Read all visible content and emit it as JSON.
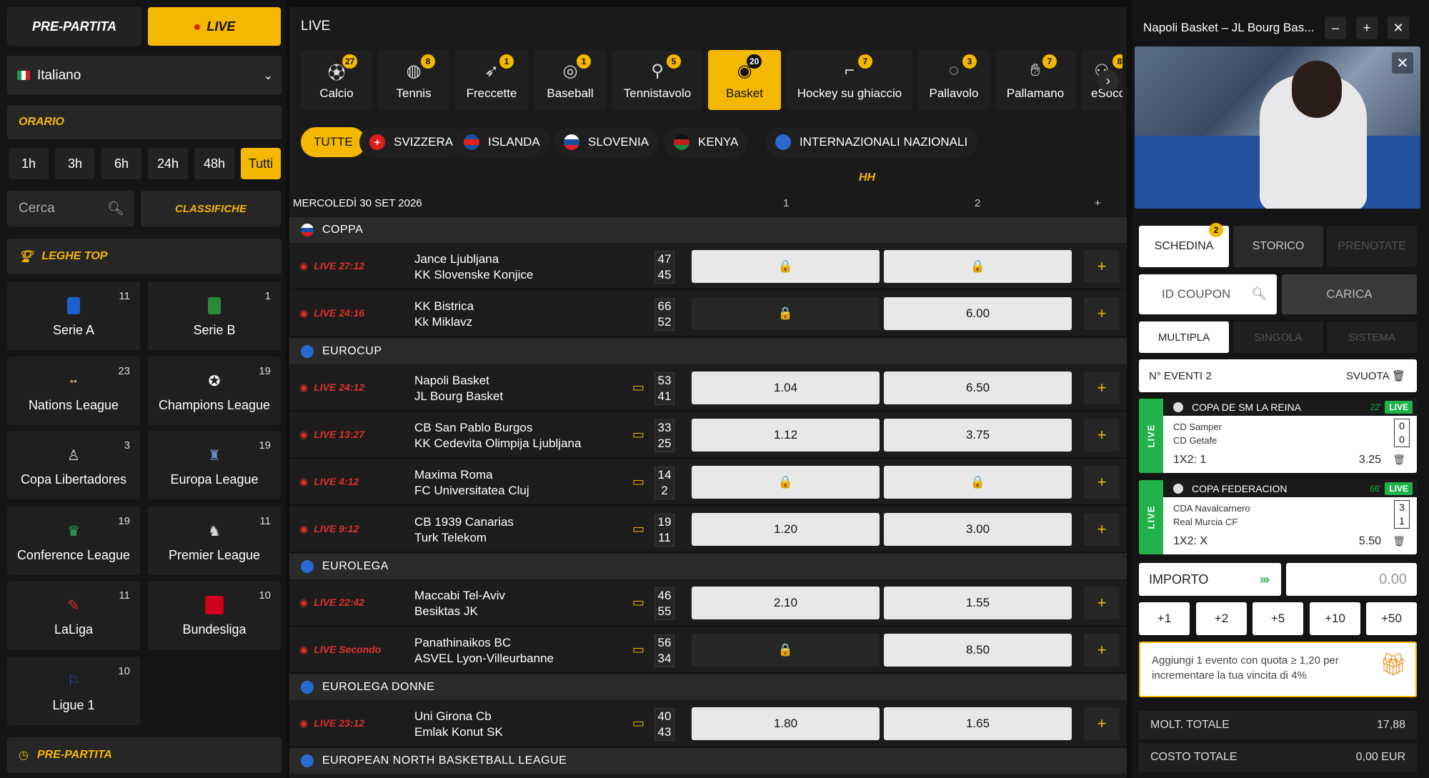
{
  "left": {
    "prepartita_label": "PRE-PARTITA",
    "live_label": "LIVE",
    "language": "Italiano",
    "orario_label": "ORARIO",
    "time_filters": [
      "1h",
      "3h",
      "6h",
      "24h",
      "48h",
      "Tutti"
    ],
    "search_placeholder": "Cerca",
    "classifiche_label": "CLASSIFICHE",
    "leghe_top_label": "LEGHE TOP",
    "leagues": [
      {
        "name": "Serie A",
        "count": "11",
        "icon": "serie-a-icon"
      },
      {
        "name": "Serie B",
        "count": "1",
        "icon": "serie-b-icon"
      },
      {
        "name": "Nations League",
        "count": "23",
        "icon": "nations-league-icon"
      },
      {
        "name": "Champions League",
        "count": "19",
        "icon": "champions-league-icon"
      },
      {
        "name": "Copa Libertadores",
        "count": "3",
        "icon": "copa-libertadores-icon"
      },
      {
        "name": "Europa League",
        "count": "19",
        "icon": "europa-league-icon"
      },
      {
        "name": "Conference League",
        "count": "19",
        "icon": "conference-league-icon"
      },
      {
        "name": "Premier League",
        "count": "11",
        "icon": "premier-league-icon"
      },
      {
        "name": "LaLiga",
        "count": "11",
        "icon": "laliga-icon"
      },
      {
        "name": "Bundesliga",
        "count": "10",
        "icon": "bundesliga-icon"
      },
      {
        "name": "Ligue 1",
        "count": "10",
        "icon": "ligue-1-icon"
      }
    ],
    "prepartita_footer": "PRE-PARTITA"
  },
  "center": {
    "title": "LIVE",
    "sports": [
      {
        "label": "Calcio",
        "count": "27",
        "icon": "soccer-ball-icon"
      },
      {
        "label": "Tennis",
        "count": "8",
        "icon": "tennis-ball-icon"
      },
      {
        "label": "Freccette",
        "count": "1",
        "icon": "dart-icon"
      },
      {
        "label": "Baseball",
        "count": "1",
        "icon": "baseball-icon"
      },
      {
        "label": "Tennistavolo",
        "count": "5",
        "icon": "ping-pong-icon"
      },
      {
        "label": "Basket",
        "count": "20",
        "icon": "basketball-icon",
        "active": true
      },
      {
        "label": "Hockey su ghiaccio",
        "count": "7",
        "icon": "hockey-stick-icon"
      },
      {
        "label": "Pallavolo",
        "count": "3",
        "icon": "volleyball-icon"
      },
      {
        "label": "Pallamano",
        "count": "7",
        "icon": "handball-icon"
      },
      {
        "label": "eSocce",
        "count": "8",
        "icon": "esoccer-icon"
      }
    ],
    "countries": [
      "TUTTE",
      "SVIZZERA",
      "ISLANDA",
      "SLOVENIA",
      "KENYA",
      "INTERNAZIONALI NAZIONALI"
    ],
    "hh_label": "HH",
    "date_header": "MERCOLEDÌ 30 SET 2026",
    "col1": "1",
    "col2": "2",
    "col_plus": "+",
    "groups": {
      "coppa": "COPPA",
      "eurocup": "EUROCUP",
      "eurolega": "EUROLEGA",
      "eurolega_donne": "EUROLEGA DONNE",
      "enbl": "EUROPEAN NORTH BASKETBALL LEAGUE"
    },
    "matches": [
      {
        "live": "LIVE 27:12",
        "home": "Jance Ljubljana",
        "away": "KK Slovenske Konjice",
        "s1": "47",
        "s2": "45",
        "o1": "🔒",
        "o2": "🔒",
        "tv": false
      },
      {
        "live": "LIVE 24:16",
        "home": "KK Bistrica",
        "away": "Kk Miklavz",
        "s1": "66",
        "s2": "52",
        "o1": "🔒",
        "o2": "6.00",
        "tv": false
      },
      {
        "live": "LIVE 24:12",
        "home": "Napoli Basket",
        "away": "JL Bourg Basket",
        "s1": "53",
        "s2": "41",
        "o1": "1.04",
        "o2": "6.50",
        "tv": true
      },
      {
        "live": "LIVE 13:27",
        "home": "CB San Pablo Burgos",
        "away": "KK Cedevita Olimpija Ljubljana",
        "s1": "33",
        "s2": "25",
        "o1": "1.12",
        "o2": "3.75",
        "tv": true
      },
      {
        "live": "LIVE 4:12",
        "home": "Maxima Roma",
        "away": "FC Universitatea Cluj",
        "s1": "14",
        "s2": "2",
        "o1": "🔒",
        "o2": "🔒",
        "tv": true
      },
      {
        "live": "LIVE 9:12",
        "home": "CB 1939 Canarias",
        "away": "Turk Telekom",
        "s1": "19",
        "s2": "11",
        "o1": "1.20",
        "o2": "3.00",
        "tv": true
      },
      {
        "live": "LIVE 22:42",
        "home": "Maccabi Tel-Aviv",
        "away": "Besiktas JK",
        "s1": "46",
        "s2": "55",
        "o1": "2.10",
        "o2": "1.55",
        "tv": true
      },
      {
        "live": "LIVE Secondo",
        "home": "Panathinaikos BC",
        "away": "ASVEL Lyon-Villeurbanne",
        "s1": "56",
        "s2": "34",
        "o1": "🔒",
        "o2": "8.50",
        "tv": true
      },
      {
        "live": "LIVE 23:12",
        "home": "Uni Girona Cb",
        "away": "Emlak Konut SK",
        "s1": "40",
        "s2": "43",
        "o1": "1.80",
        "o2": "1.65",
        "tv": true
      }
    ]
  },
  "right": {
    "video_title": "Napoli Basket – JL Bourg Bas...",
    "minimize": "–",
    "expand": "+",
    "close": "✕",
    "tabs": {
      "schedina": "SCHEDINA",
      "schedina_badge": "2",
      "storico": "STORICO",
      "prenotate": "PRENOTATE"
    },
    "coupon_placeholder": "ID COUPON",
    "carica": "CARICA",
    "modes": [
      "MULTIPLA",
      "SINGOLA",
      "SISTEMA"
    ],
    "n_eventi": "N° EVENTI 2",
    "svuota": "SVUOTA",
    "bets": [
      {
        "side": "LIVE",
        "competition": "COPA DE SM LA REINA",
        "minute": "22'",
        "live": "LIVE",
        "home": "CD Samper",
        "away": "CD Getafe",
        "s1": "0",
        "s2": "0",
        "market": "1X2:  1",
        "odd": "3.25"
      },
      {
        "side": "LIVE",
        "competition": "COPA FEDERACION",
        "minute": "66'",
        "live": "LIVE",
        "home": "CDA Navalcarnero",
        "away": "Real Murcia CF",
        "s1": "3",
        "s2": "1",
        "market": "1X2:  X",
        "odd": "5.50"
      }
    ],
    "importo": "IMPORTO",
    "amount": "0.00",
    "quick": [
      "+1",
      "+2",
      "+5",
      "+10",
      "+50"
    ],
    "bonus_text": "Aggiungi 1 evento con quota ≥ 1,20 per incrementare la tua vincita di 4%",
    "molt_label": "MOLT. TOTALE",
    "molt_value": "17,88",
    "costo_label": "COSTO TOTALE",
    "costo_value": "0,00 EUR"
  }
}
